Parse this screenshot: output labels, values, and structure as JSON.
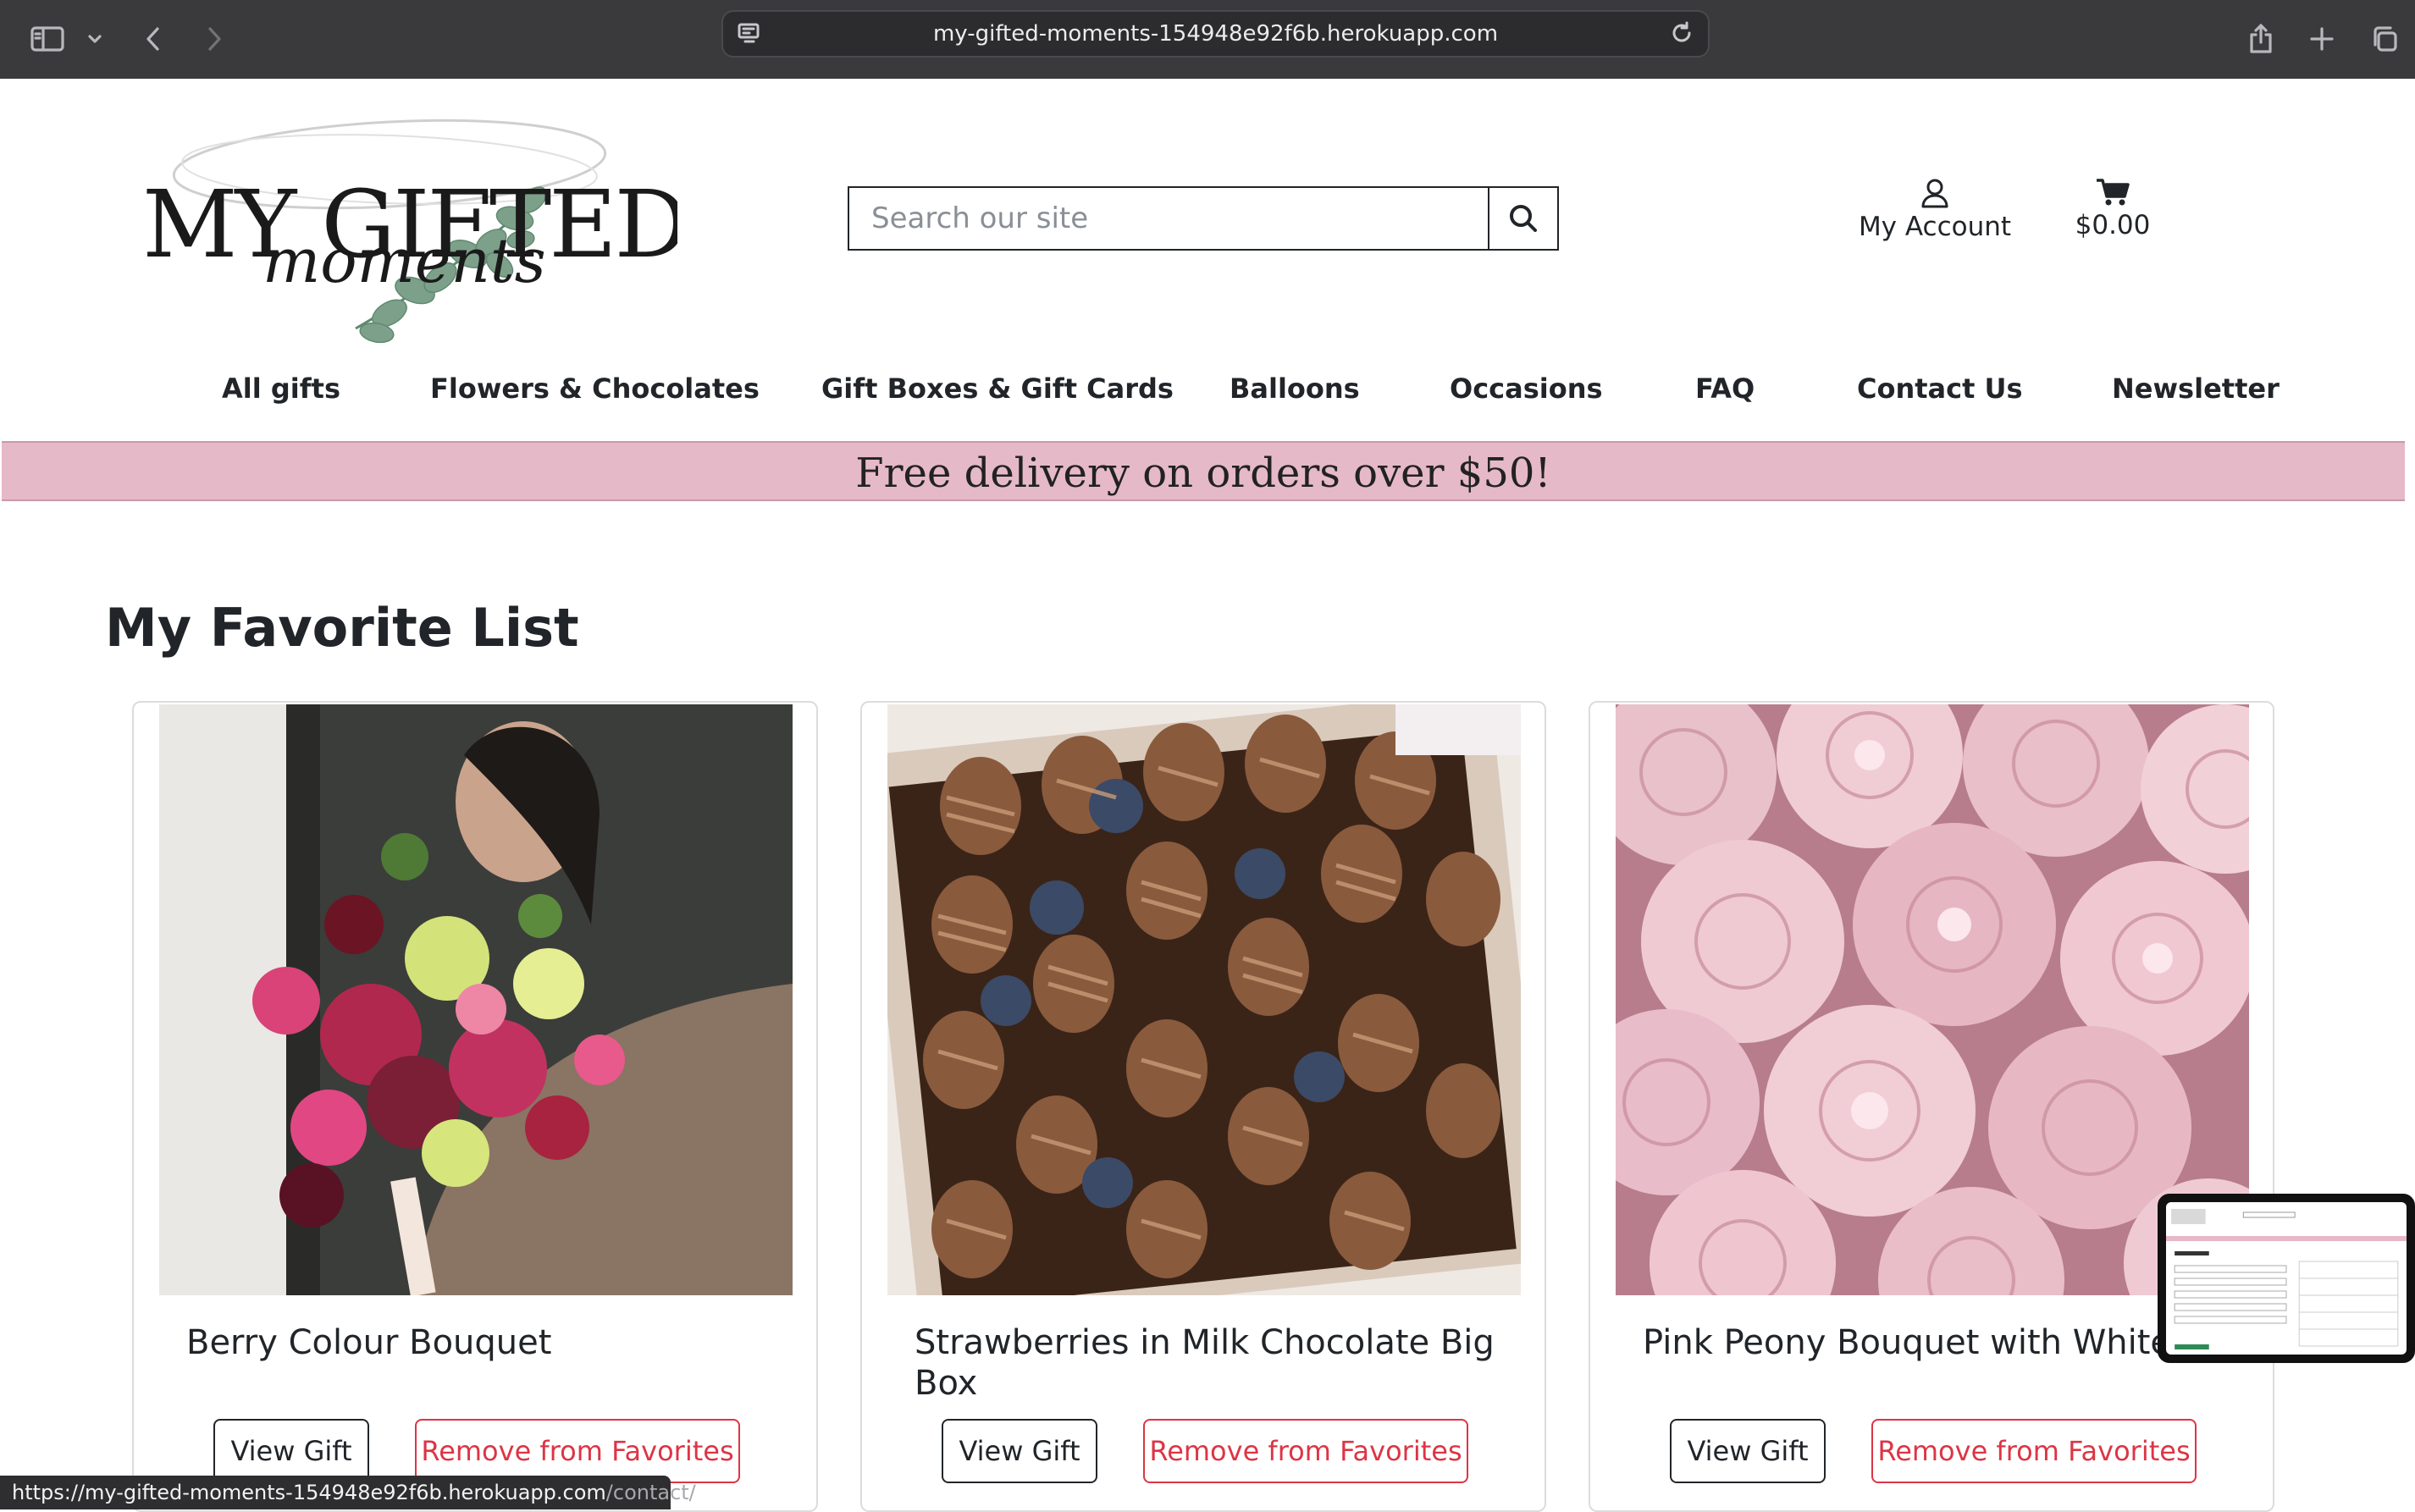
{
  "browser": {
    "url": "my-gifted-moments-154948e92f6b.herokuapp.com"
  },
  "header": {
    "logo": {
      "line1": "MY GIFTED",
      "line2": "moments"
    },
    "search_placeholder": "Search our site",
    "account_label": "My Account",
    "cart_total": "$0.00"
  },
  "nav": {
    "items": [
      "All gifts",
      "Flowers & Chocolates",
      "Gift Boxes & Gift Cards",
      "Balloons",
      "Occasions",
      "FAQ",
      "Contact Us",
      "Newsletter"
    ]
  },
  "banner": {
    "text": "Free delivery on orders over $50!"
  },
  "page": {
    "title": "My Favorite List"
  },
  "favorites": [
    {
      "name": "Berry Colour Bouquet",
      "view_label": "View Gift",
      "remove_label": "Remove from Favorites"
    },
    {
      "name": "Strawberries in Milk Chocolate Big Box",
      "view_label": "View Gift",
      "remove_label": "Remove from Favorites"
    },
    {
      "name": "Pink Peony Bouquet with White",
      "view_label": "View Gift",
      "remove_label": "Remove from Favorites"
    }
  ],
  "status_bar": {
    "url_main": "https://my-gifted-moments-154948e92f6b.herokuapp.com",
    "url_path": "/contact/"
  },
  "colors": {
    "banner_bg": "#e6b9c8",
    "danger": "#dc3545",
    "chrome_bg": "#3a3a3c"
  }
}
